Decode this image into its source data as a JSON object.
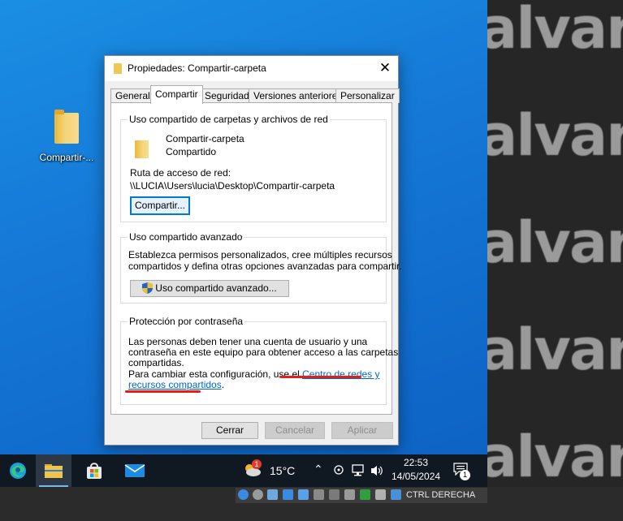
{
  "desktop": {
    "icon_label": "Compartir-...",
    "side_text": "alvare"
  },
  "dialog": {
    "title": "Propiedades: Compartir-carpeta",
    "tabs": [
      {
        "label": "General"
      },
      {
        "label": "Compartir"
      },
      {
        "label": "Seguridad"
      },
      {
        "label": "Versiones anteriores"
      },
      {
        "label": "Personalizar"
      }
    ],
    "active_tab": "Compartir",
    "network_sharing": {
      "title": "Uso compartido de carpetas y archivos de red",
      "folder_name": "Compartir-carpeta",
      "folder_status": "Compartido",
      "path_label": "Ruta de acceso de red:",
      "path_value": "\\\\LUCIA\\Users\\lucia\\Desktop\\Compartir-carpeta",
      "share_button": "Compartir..."
    },
    "advanced_sharing": {
      "title": "Uso compartido avanzado",
      "description_1": "Establezca permisos personalizados, cree múltiples recursos",
      "description_2": "compartidos y defina otras opciones avanzadas para compartir.",
      "button": "Uso compartido avanzado..."
    },
    "password_protection": {
      "title": "Protección por contraseña",
      "line_1": "Las personas deben tener una cuenta de usuario y una",
      "line_2": "contraseña en este equipo para obtener acceso a las carpetas",
      "line_3": "compartidas.",
      "line_4_prefix": "Para cambiar esta configuración, use el ",
      "link_part_1": "Centro de redes y",
      "link_part_2": "recursos compartidos",
      "line_5_suffix": "."
    },
    "buttons": {
      "close": "Cerrar",
      "cancel": "Cancelar",
      "apply": "Aplicar"
    }
  },
  "taskbar": {
    "weather_badge": "1",
    "temperature": "15°C",
    "time": "22:53",
    "date": "14/05/2024",
    "notification_count": "1"
  },
  "vbox": {
    "host_key": "CTRL DERECHA"
  },
  "colors": {
    "accent": "#0078d7",
    "link": "#0066cc",
    "annotation": "#e0201c"
  }
}
